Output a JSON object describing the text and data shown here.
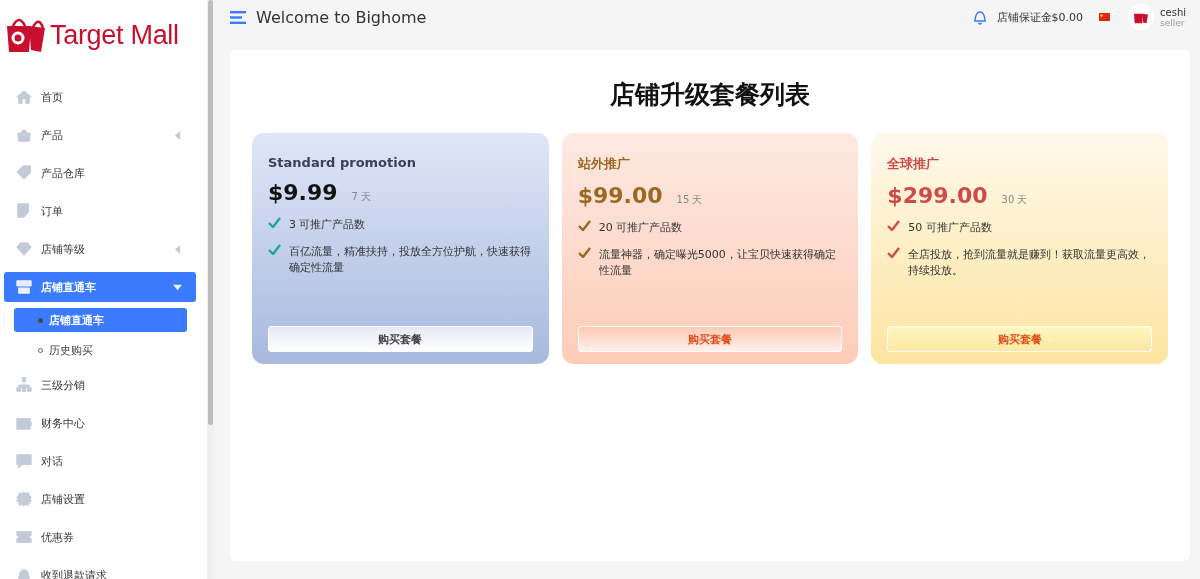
{
  "logo": {
    "text": "Target Mall"
  },
  "sidebar": {
    "items": [
      {
        "label": "首页",
        "selected": false
      },
      {
        "label": "产品",
        "expanded": false,
        "selected": false
      },
      {
        "label": "产品仓库",
        "selected": false
      },
      {
        "label": "订单",
        "selected": false
      },
      {
        "label": "店铺等级",
        "expanded": false,
        "selected": false
      },
      {
        "label": "店铺直通车",
        "expanded": true,
        "selected": true,
        "children": [
          {
            "label": "店铺直通车",
            "selected": true
          },
          {
            "label": "历史购买",
            "selected": false
          }
        ]
      },
      {
        "label": "三级分销",
        "selected": false
      },
      {
        "label": "财务中心",
        "selected": false
      },
      {
        "label": "对话",
        "selected": false
      },
      {
        "label": "店铺设置",
        "selected": false
      },
      {
        "label": "优惠券",
        "selected": false
      },
      {
        "label": "收到退款请求",
        "selected": false
      }
    ]
  },
  "header": {
    "title": "Welcome to Bighome",
    "deposit": "店铺保证金$0.00",
    "user": {
      "name": "ceshi",
      "role": "seller"
    }
  },
  "page_title": "店铺升级套餐列表",
  "plans": [
    {
      "kind": "standard",
      "name": "Standard promotion",
      "price": "$9.99",
      "duration": "7 天",
      "features": [
        "3 可推广产品数",
        "百亿流量，精准扶持，投放全方位护航，快速获得确定性流量"
      ],
      "button": "购买套餐"
    },
    {
      "kind": "offsite",
      "name": "站外推广",
      "price": "$99.00",
      "duration": "15 天",
      "features": [
        "20 可推广产品数",
        "流量神器，确定曝光5000，让宝贝快速获得确定性流量"
      ],
      "button": "购买套餐"
    },
    {
      "kind": "global",
      "name": "全球推广",
      "price": "$299.00",
      "duration": "30 天",
      "features": [
        "50 可推广产品数",
        "全店投放，抢到流量就是赚到！获取流量更高效，持续投放。"
      ],
      "button": "购买套餐"
    }
  ]
}
